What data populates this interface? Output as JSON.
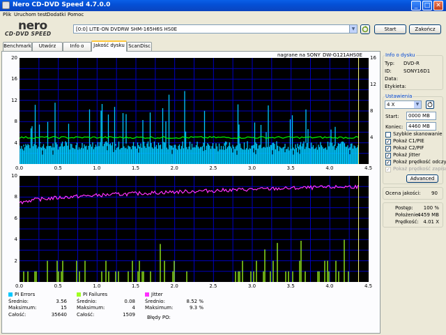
{
  "window": {
    "title": "Nero CD-DVD Speed 4.7.0.0"
  },
  "menu": [
    "Plik",
    "Uruchom test",
    "Dodatki",
    "Pomoc"
  ],
  "logo": {
    "line1": "nero",
    "line2": "CD·DVD SPEED"
  },
  "toolbar": {
    "drive": "[0:0]  LITE-ON DVDRW SHM-165H6S HS0E",
    "start": "Start",
    "close": "Zakończ"
  },
  "tabs": [
    "Benchmark",
    "Utwórz dysk",
    "Info o dysku",
    "Jakość dysku",
    "ScanDisc"
  ],
  "active_tab": "Jakość dysku",
  "chart_header": {
    "recorded_on": "nagrane na SONY",
    "media": "DW-G121AHS0E"
  },
  "colors": {
    "pie": "#00c8ff",
    "pif": "#a0ff20",
    "jitter": "#ff30ff",
    "speed": "#00ff00",
    "grid": "#0000c0"
  },
  "chart_data": [
    {
      "type": "bar",
      "name": "PI Errors",
      "xlim": [
        0,
        4.5
      ],
      "ylim": [
        0,
        20
      ],
      "y2lim": [
        0,
        16
      ],
      "x_ticks": [
        "0.0",
        "0.5",
        "1.0",
        "1.5",
        "2.0",
        "2.5",
        "3.0",
        "3.5",
        "4.0",
        "4.5"
      ],
      "y_ticks": [
        "4",
        "8",
        "12",
        "16",
        "20"
      ],
      "y2_ticks": [
        "4",
        "8",
        "12",
        "16"
      ],
      "baseline": 3.5,
      "peak": 15,
      "speed_level": 4
    },
    {
      "type": "bar",
      "name": "PI Failures / Jitter",
      "xlim": [
        0,
        4.5
      ],
      "ylim": [
        0,
        10
      ],
      "x_ticks": [
        "0.0",
        "0.5",
        "1.0",
        "1.5",
        "2.0",
        "2.5",
        "3.0",
        "3.5",
        "4.0",
        "4.5"
      ],
      "y_ticks": [
        "2",
        "4",
        "6",
        "8",
        "10"
      ],
      "jitter_start": 7.4,
      "jitter_end": 9.0,
      "pif_max": 4
    }
  ],
  "stats": {
    "pie": {
      "title": "PI Errors",
      "avg_label": "Średnio:",
      "avg": "3.56",
      "max_label": "Maksimum:",
      "max": "15",
      "total_label": "Całość:",
      "total": "35640"
    },
    "pif": {
      "title": "PI Failures",
      "avg_label": "Średnio:",
      "avg": "0.08",
      "max_label": "Maksimum:",
      "max": "4",
      "total_label": "Całość:",
      "total": "1509"
    },
    "jitter": {
      "title": "Jitter",
      "avg_label": "Średnio:",
      "avg": "8.52 %",
      "max_label": "Maksimum:",
      "max": "9.3 %"
    },
    "po_label": "Błędy PO:"
  },
  "disc_info": {
    "title": "Info o dysku",
    "type_label": "Typ:",
    "type": "DVD-R",
    "id_label": "ID:",
    "id": "SONY16D1",
    "date_label": "Data:",
    "label_label": "Etykieta:"
  },
  "settings": {
    "title": "Ustawienia",
    "speed": "4 X",
    "start_label": "Start:",
    "start": "0000 MB",
    "end_label": "Koniec:",
    "end": "4460 MB",
    "checks": [
      {
        "label": "Szybkie skanowanie",
        "checked": false,
        "disabled": false
      },
      {
        "label": "Pokaż C1/PIE",
        "checked": true,
        "disabled": false
      },
      {
        "label": "Pokaż C2/PIF",
        "checked": true,
        "disabled": false
      },
      {
        "label": "Pokaż Jitter",
        "checked": true,
        "disabled": false
      },
      {
        "label": "Pokaż prędkość odczy",
        "checked": true,
        "disabled": false
      },
      {
        "label": "Pokaż prędkość zapisu",
        "checked": true,
        "disabled": true
      }
    ],
    "advanced": "Advanced"
  },
  "quality": {
    "label": "Ocena jakości:",
    "value": "90"
  },
  "progress": {
    "progress_label": "Postęp:",
    "progress": "100 %",
    "position_label": "Położenie:",
    "position": "4459 MB",
    "speed_label": "Prędkość:",
    "speed": "4.01 X"
  }
}
